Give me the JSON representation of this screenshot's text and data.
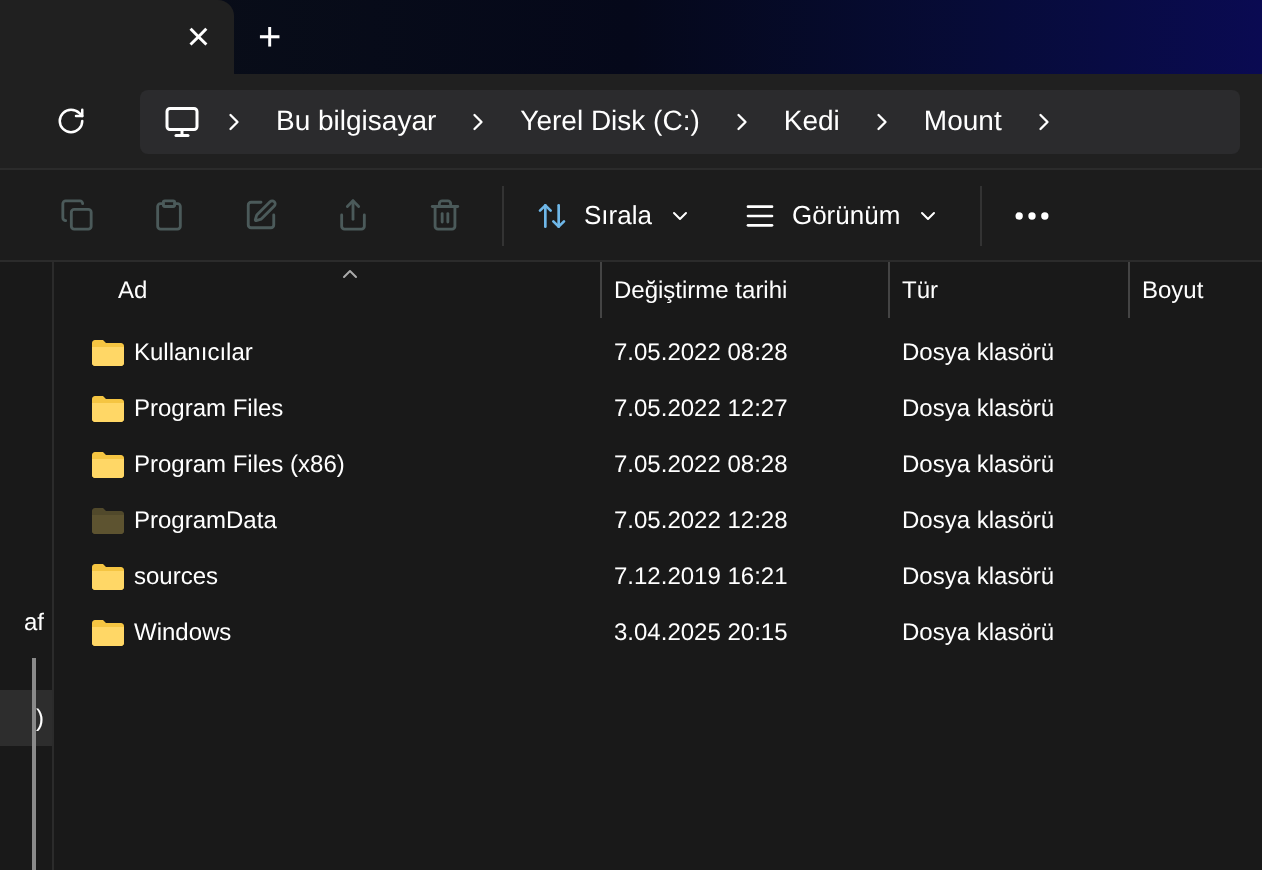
{
  "tab": {
    "close": "×",
    "new": "+"
  },
  "breadcrumb": [
    "Bu bilgisayar",
    "Yerel Disk (C:)",
    "Kedi",
    "Mount"
  ],
  "toolbar": {
    "sort": "Sırala",
    "view": "Görünüm"
  },
  "sidebar": [
    {
      "label": "af",
      "selected": false
    },
    {
      "label": ")",
      "selected": true
    }
  ],
  "table": {
    "columns": [
      "Ad",
      "Değiştirme tarihi",
      "Tür",
      "Boyut"
    ],
    "rows": [
      {
        "name": "Kullanıcılar",
        "date": "7.05.2022 08:28",
        "type": "Dosya klasörü",
        "hidden": false
      },
      {
        "name": "Program Files",
        "date": "7.05.2022 12:27",
        "type": "Dosya klasörü",
        "hidden": false
      },
      {
        "name": "Program Files (x86)",
        "date": "7.05.2022 08:28",
        "type": "Dosya klasörü",
        "hidden": false
      },
      {
        "name": "ProgramData",
        "date": "7.05.2022 12:28",
        "type": "Dosya klasörü",
        "hidden": true
      },
      {
        "name": "sources",
        "date": "7.12.2019 16:21",
        "type": "Dosya klasörü",
        "hidden": false
      },
      {
        "name": "Windows",
        "date": "3.04.2025 20:15",
        "type": "Dosya klasörü",
        "hidden": false
      }
    ]
  }
}
